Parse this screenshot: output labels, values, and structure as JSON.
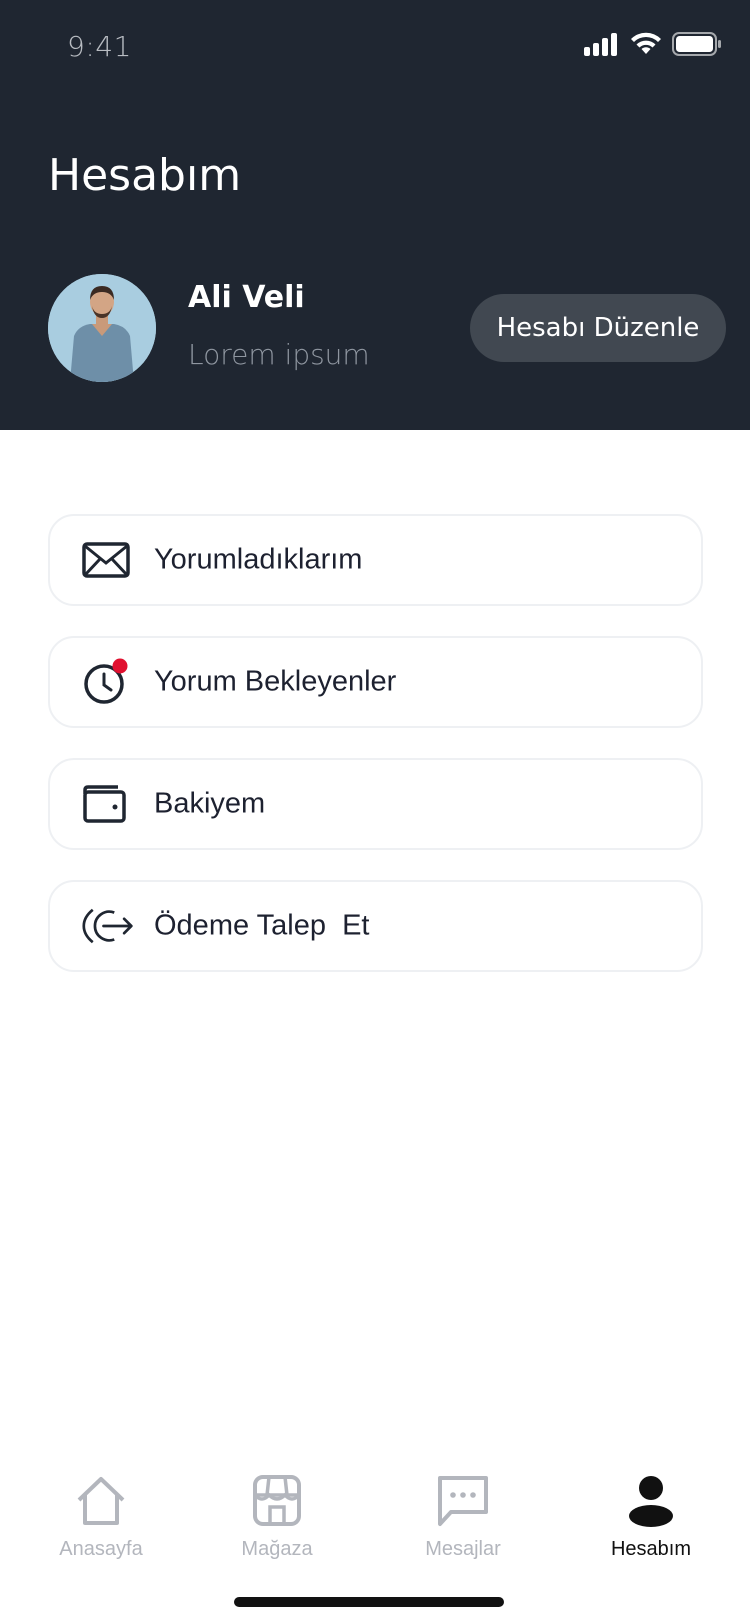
{
  "status_bar": {
    "time": "9:41"
  },
  "header": {
    "title": "Hesabım",
    "user_name": "Ali Veli",
    "user_subtitle": "Lorem ipsum",
    "edit_button_label": "Hesabı Düzenle"
  },
  "menu": {
    "items": [
      {
        "label": "Yorumladıklarım",
        "icon": "envelope-icon"
      },
      {
        "label": "Yorum Bekleyenler",
        "icon": "clock-icon",
        "badge": true
      },
      {
        "label": "Bakiyem",
        "icon": "wallet-icon"
      },
      {
        "label": "Ödeme Talep  Et",
        "icon": "logout-icon"
      }
    ]
  },
  "tabbar": {
    "items": [
      {
        "label": "Anasayfa",
        "icon": "home-icon",
        "active": false
      },
      {
        "label": "Mağaza",
        "icon": "store-icon",
        "active": false
      },
      {
        "label": "Mesajlar",
        "icon": "chat-icon",
        "active": false
      },
      {
        "label": "Hesabım",
        "icon": "user-icon",
        "active": true
      }
    ]
  },
  "colors": {
    "header_bg": "#1f2631",
    "badge": "#e0102f",
    "tab_inactive": "#b3b6bd",
    "tab_active": "#111111"
  }
}
